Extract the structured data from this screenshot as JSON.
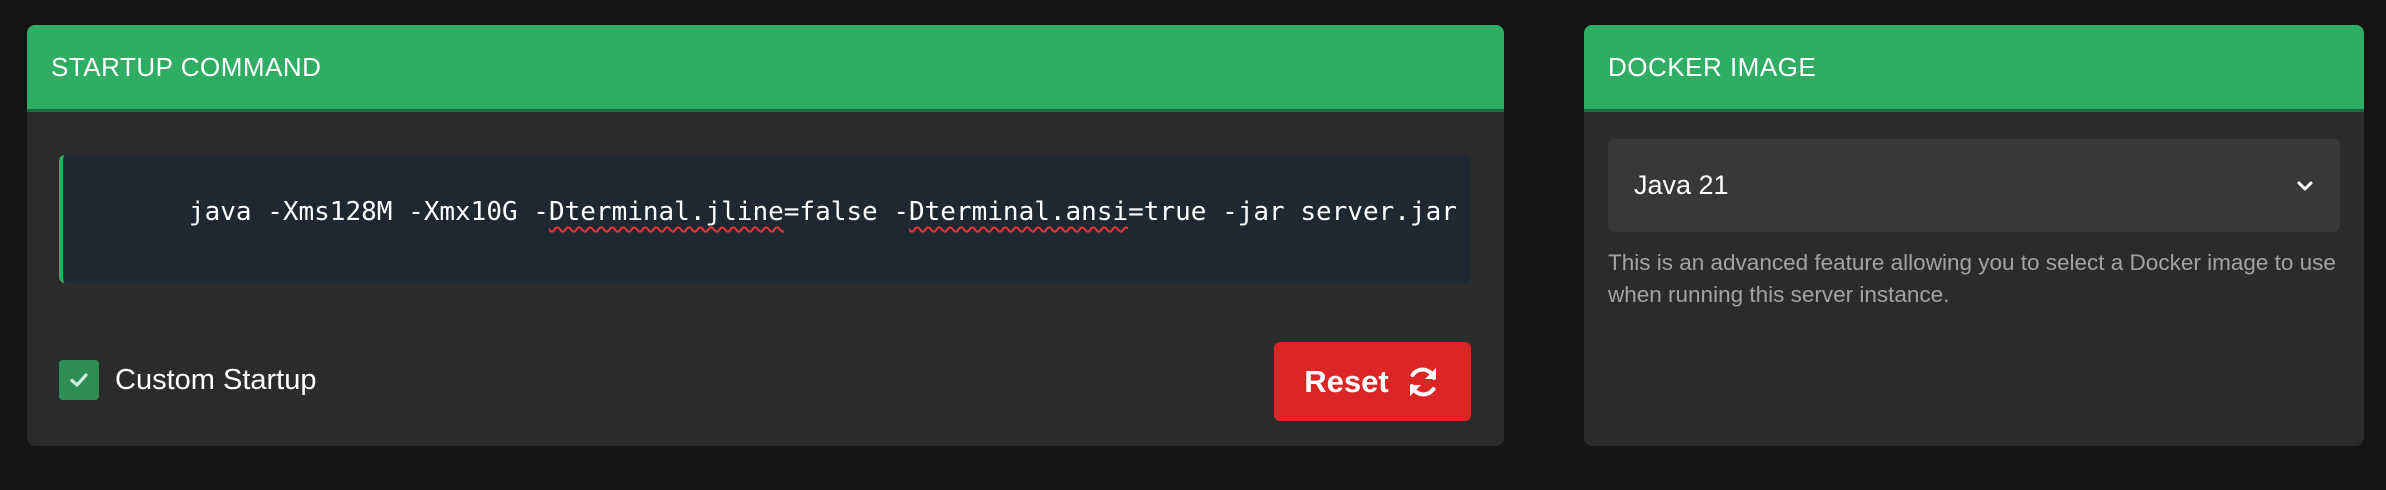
{
  "startup": {
    "title": "STARTUP COMMAND",
    "command_parts": [
      {
        "text": "java -Xms128M -Xmx10G -",
        "squiggle": false
      },
      {
        "text": "Dterminal.jline",
        "squiggle": true
      },
      {
        "text": "=false -",
        "squiggle": false
      },
      {
        "text": "Dterminal.ansi",
        "squiggle": true
      },
      {
        "text": "=true -jar server.jar",
        "squiggle": false
      }
    ],
    "custom_startup_label": "Custom Startup",
    "custom_startup_checked": true,
    "reset_label": "Reset"
  },
  "docker": {
    "title": "DOCKER IMAGE",
    "selected_image": "Java 21",
    "help_text": "This is an advanced feature allowing you to select a Docker image to use when running this server instance."
  },
  "icons": {
    "checkbox": "check-icon",
    "reset": "refresh-icon",
    "select": "chevron-down-icon"
  },
  "colors": {
    "header": "#30ad65",
    "reset": "#dc2626",
    "checkbox": "#2f8e54",
    "command_bg": "#1f2732"
  }
}
